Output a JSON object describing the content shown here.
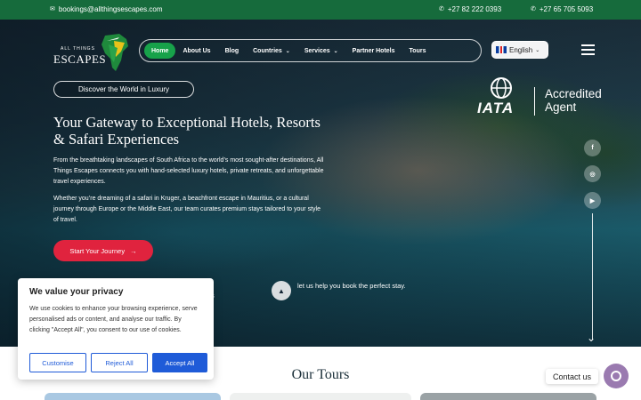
{
  "topbar": {
    "email": "bookings@allthingsescapes.com",
    "phone1": "+27 82 222 0393",
    "phone2": "+27 65 705 5093"
  },
  "logo": {
    "small": "ALL THINGS",
    "big": "ESCAPES"
  },
  "nav": {
    "items": [
      {
        "label": "Home",
        "active": true
      },
      {
        "label": "About Us"
      },
      {
        "label": "Blog"
      },
      {
        "label": "Countries",
        "dropdown": true
      },
      {
        "label": "Services",
        "dropdown": true
      },
      {
        "label": "Partner Hotels"
      },
      {
        "label": "Tours"
      }
    ]
  },
  "language": {
    "selected": "English"
  },
  "hero": {
    "pill": "Discover the World in Luxury",
    "headline": "Your Gateway to Exceptional Hotels, Resorts & Safari Experiences",
    "para1": "From the breathtaking landscapes of South Africa to the world’s most sought-after destinations, All Things Escapes connects you with hand-selected luxury hotels, private retreats, and unforgettable travel experiences.",
    "para2": "Whether you’re dreaming of a safari in Kruger, a beachfront escape in Mauritius, or a cultural journey through Europe or the Middle East, our team curates premium stays tailored to your style of travel.",
    "cta": "Start Your Journey",
    "help_text": "let us help you book the perfect stay.",
    "help_fragment": "s"
  },
  "iata": {
    "word": "IATA",
    "accredited": "Accredited",
    "agent": "Agent"
  },
  "social": [
    "f",
    "◎",
    "▶"
  ],
  "section": {
    "tours_title": "Our Tours"
  },
  "cookie": {
    "title": "We value your privacy",
    "body": "We use cookies to enhance your browsing experience, serve personalised ads or content, and analyse our traffic. By clicking \"Accept All\", you consent to our use of cookies.",
    "customise": "Customise",
    "reject": "Reject All",
    "accept": "Accept All"
  },
  "chat": {
    "label": "Contact us"
  },
  "colors": {
    "topbar": "#166b3c",
    "active_nav": "#17a24a",
    "cta": "#e0233e",
    "cookie_accent": "#1f5bd8",
    "chat": "#9a7ab0"
  }
}
